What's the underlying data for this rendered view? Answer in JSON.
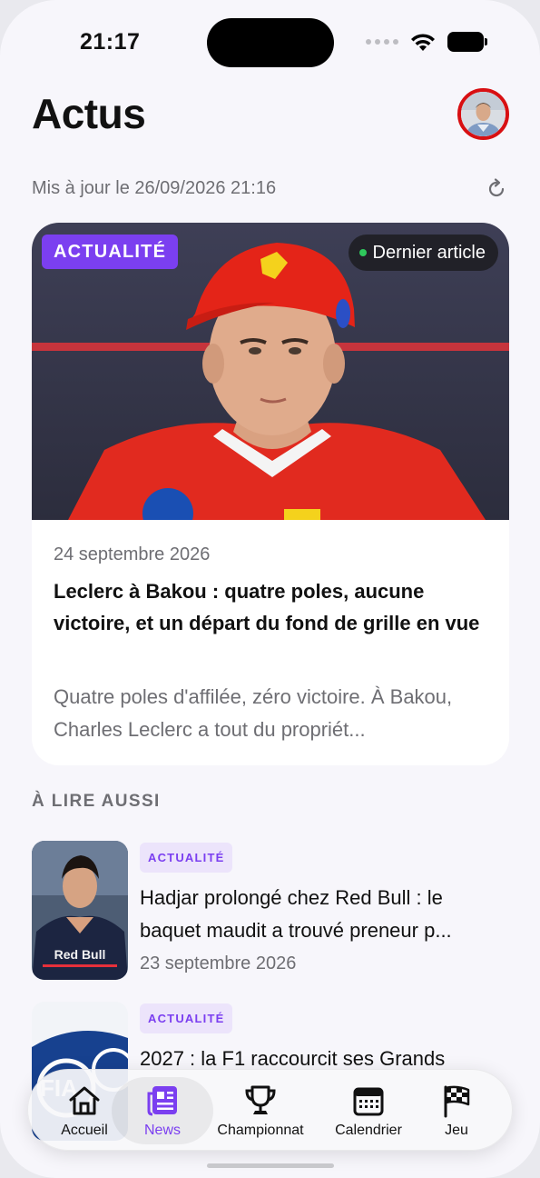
{
  "status_bar": {
    "time": "21:17"
  },
  "header": {
    "title": "Actus"
  },
  "updated": {
    "text": "Mis à jour le 26/09/2026 21:16"
  },
  "hero": {
    "badge": "ACTUALITÉ",
    "latest_label": "Dernier article",
    "date": "24 septembre 2026",
    "title": "Leclerc à Bakou : quatre poles, aucune victoire, et un départ du fond de grille en vue",
    "excerpt": "Quatre poles d'affilée, zéro victoire. À Bakou, Charles Leclerc a tout du propriét..."
  },
  "section": {
    "label": "À LIRE AUSSI"
  },
  "articles": [
    {
      "badge": "ACTUALITÉ",
      "title": "Hadjar prolongé chez Red Bull : le baquet maudit a trouvé preneur p...",
      "date": "23 septembre 2026"
    },
    {
      "badge": "ACTUALITÉ",
      "title": "2027 : la F1 raccourcit ses Grands",
      "date": ""
    }
  ],
  "tabbar": {
    "items": [
      {
        "label": "Accueil"
      },
      {
        "label": "News"
      },
      {
        "label": "Championnat"
      },
      {
        "label": "Calendrier"
      },
      {
        "label": "Jeu"
      }
    ],
    "active_index": 1
  },
  "colors": {
    "accent": "#7b3ff0",
    "avatar_ring": "#d80f12",
    "live_dot": "#2fc85c"
  }
}
